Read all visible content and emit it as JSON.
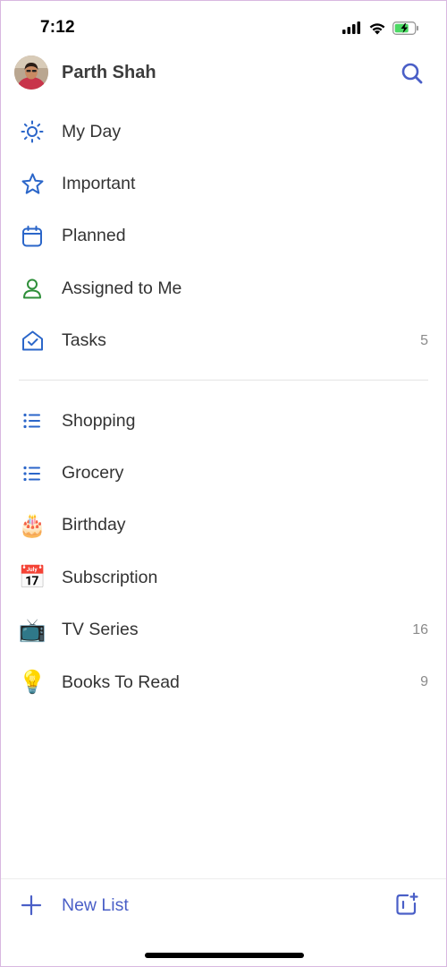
{
  "status_bar": {
    "time": "7:12"
  },
  "header": {
    "user_name": "Parth Shah"
  },
  "smart_lists": [
    {
      "label": "My Day",
      "icon": "sun-icon",
      "color": "#2b66c9",
      "count": ""
    },
    {
      "label": "Important",
      "icon": "star-icon",
      "color": "#2b66c9",
      "count": ""
    },
    {
      "label": "Planned",
      "icon": "calendar-icon",
      "color": "#2b66c9",
      "count": ""
    },
    {
      "label": "Assigned to Me",
      "icon": "person-icon",
      "color": "#2f8f3a",
      "count": ""
    },
    {
      "label": "Tasks",
      "icon": "home-check-icon",
      "color": "#2b66c9",
      "count": "5"
    }
  ],
  "user_lists": [
    {
      "label": "Shopping",
      "icon": "list-icon",
      "count": ""
    },
    {
      "label": "Grocery",
      "icon": "list-icon",
      "count": ""
    },
    {
      "label": "Birthday",
      "icon": "birthday-cake-icon",
      "emoji": "🎂",
      "count": ""
    },
    {
      "label": "Subscription",
      "icon": "calendar-emoji-icon",
      "emoji": "📅",
      "count": ""
    },
    {
      "label": "TV Series",
      "icon": "television-icon",
      "emoji": "📺",
      "count": "16"
    },
    {
      "label": "Books To Read",
      "icon": "light-bulb-icon",
      "emoji": "💡",
      "count": "9"
    }
  ],
  "footer": {
    "new_list_label": "New List"
  },
  "colors": {
    "accent": "#4a5fc7",
    "list_icon": "#2b66c9",
    "text": "#333333",
    "count": "#8a8a8a"
  }
}
